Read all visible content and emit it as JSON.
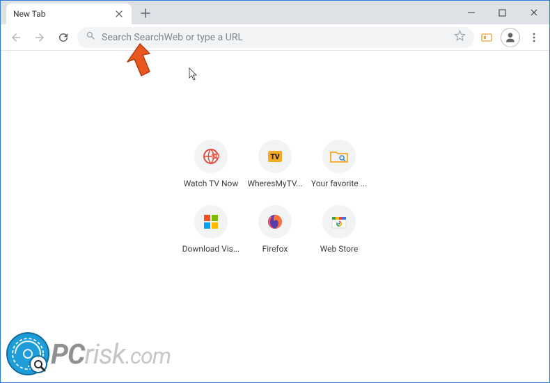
{
  "window": {
    "tab_title": "New Tab"
  },
  "toolbar": {
    "omnibox_placeholder": "Search SearchWeb or type a URL"
  },
  "shortcuts": [
    {
      "label": "Watch TV Now",
      "icon": "globe-live"
    },
    {
      "label": "WheresMyTV...",
      "icon": "tv-badge"
    },
    {
      "label": "Your favorite ...",
      "icon": "folder-search"
    },
    {
      "label": "Download Vis...",
      "icon": "ms-panes"
    },
    {
      "label": "Firefox",
      "icon": "firefox"
    },
    {
      "label": "Web Store",
      "icon": "webstore"
    }
  ],
  "watermark": {
    "pc": "PC",
    "risk": "risk",
    "com": ".com"
  }
}
